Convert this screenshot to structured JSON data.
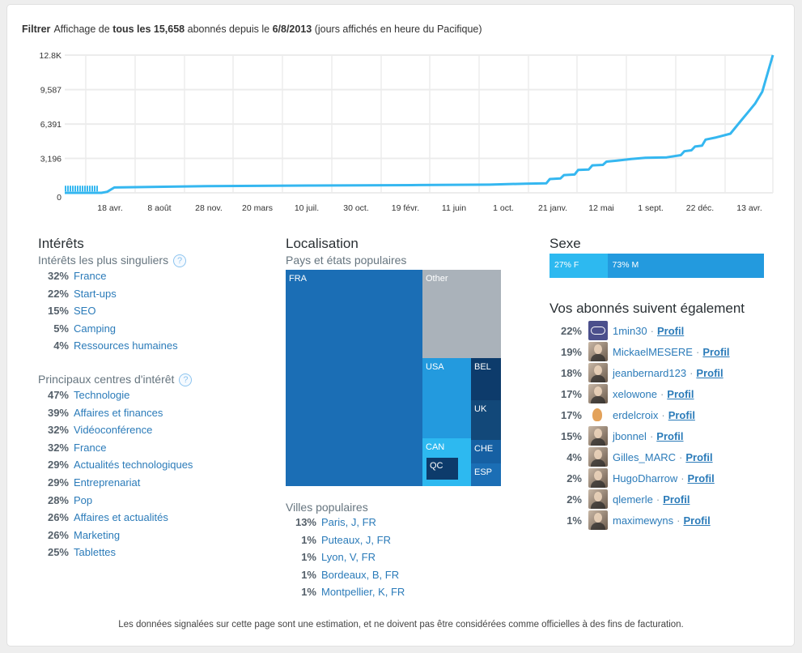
{
  "header": {
    "filter_label": "Filtrer",
    "text_parts": [
      "Affichage de ",
      "tous les 15,658",
      " abonnés depuis le ",
      "6/8/2013",
      " (jours affichés en heure du Pacifique)"
    ]
  },
  "chart_data": {
    "type": "line",
    "title": "",
    "xlabel": "",
    "ylabel": "",
    "ylim": [
      0,
      12800
    ],
    "y_ticks": [
      0,
      3196,
      6391,
      9587,
      12800
    ],
    "y_tick_labels": [
      "0",
      "3,196",
      "6,391",
      "9,587",
      "12.8K"
    ],
    "x_tick_labels": [
      "18 avr.",
      "8 août",
      "28 nov.",
      "20 mars",
      "10 juil.",
      "30 oct.",
      "19 févr.",
      "11 juin",
      "1 oct.",
      "21 janv.",
      "12 mai",
      "1 sept.",
      "22 déc.",
      "13 avr."
    ],
    "grid": true,
    "line_color": "#35b7f0",
    "series": [
      {
        "name": "abonnés",
        "x": [
          0,
          0.052,
          0.06,
          0.07,
          0.2,
          0.35,
          0.5,
          0.6,
          0.65,
          0.68,
          0.685,
          0.7,
          0.705,
          0.72,
          0.725,
          0.74,
          0.745,
          0.76,
          0.765,
          0.78,
          0.8,
          0.82,
          0.85,
          0.87,
          0.875,
          0.885,
          0.89,
          0.9,
          0.905,
          0.92,
          0.94,
          0.955,
          0.965,
          0.975,
          0.985,
          1.0
        ],
        "values": [
          0,
          0,
          100,
          500,
          620,
          680,
          720,
          760,
          850,
          880,
          1280,
          1330,
          1650,
          1700,
          2120,
          2170,
          2550,
          2600,
          2900,
          3000,
          3150,
          3250,
          3300,
          3500,
          3860,
          3950,
          4300,
          4380,
          4950,
          5150,
          5500,
          6700,
          7500,
          8300,
          9400,
          12800
        ]
      }
    ],
    "dashed_start": {
      "from": 0,
      "to": 0.048,
      "value": 400
    }
  },
  "interests": {
    "title": "Intérêts",
    "unique_title": "Intérêts les plus singuliers",
    "unique": [
      {
        "pct": "32%",
        "label": "France"
      },
      {
        "pct": "22%",
        "label": "Start-ups"
      },
      {
        "pct": "15%",
        "label": "SEO"
      },
      {
        "pct": "5%",
        "label": "Camping"
      },
      {
        "pct": "4%",
        "label": "Ressources humaines"
      }
    ],
    "top_title": "Principaux centres d'intérêt",
    "top": [
      {
        "pct": "47%",
        "label": "Technologie"
      },
      {
        "pct": "39%",
        "label": "Affaires et finances"
      },
      {
        "pct": "32%",
        "label": "Vidéoconférence"
      },
      {
        "pct": "32%",
        "label": "France"
      },
      {
        "pct": "29%",
        "label": "Actualités technologiques"
      },
      {
        "pct": "29%",
        "label": "Entreprenariat"
      },
      {
        "pct": "28%",
        "label": "Pop"
      },
      {
        "pct": "26%",
        "label": "Affaires et actualités"
      },
      {
        "pct": "26%",
        "label": "Marketing"
      },
      {
        "pct": "25%",
        "label": "Tablettes"
      }
    ],
    "help_glyph": "?"
  },
  "location": {
    "title": "Localisation",
    "countries_title": "Pays et états populaires",
    "treemap": [
      {
        "label": "FRA",
        "color": "#1b6eb5"
      },
      {
        "label": "Other",
        "color": "#aab2ba"
      },
      {
        "label": "USA",
        "color": "#239ade"
      },
      {
        "label": "BEL",
        "color": "#0d3b6b"
      },
      {
        "label": "UK",
        "color": "#124879"
      },
      {
        "label": "CAN",
        "color": "#2db9f0"
      },
      {
        "label": "QC",
        "color": "#0d3b6b"
      },
      {
        "label": "CHE",
        "color": "#1660a3"
      },
      {
        "label": "ESP",
        "color": "#1b6eb5"
      }
    ],
    "cities_title": "Villes populaires",
    "cities": [
      {
        "pct": "13%",
        "label": "Paris, J, FR"
      },
      {
        "pct": "1%",
        "label": "Puteaux, J, FR"
      },
      {
        "pct": "1%",
        "label": "Lyon, V, FR"
      },
      {
        "pct": "1%",
        "label": "Bordeaux, B, FR"
      },
      {
        "pct": "1%",
        "label": "Montpellier, K, FR"
      }
    ]
  },
  "gender": {
    "title": "Sexe",
    "female": {
      "label": "27% F",
      "fraction": 0.27,
      "color": "#2db9f0"
    },
    "male": {
      "label": "73% M",
      "fraction": 0.73,
      "color": "#239ade"
    }
  },
  "follows": {
    "title": "Vos abonnés suivent également",
    "profile_label": "Profil",
    "separator": "·",
    "items": [
      {
        "pct": "22%",
        "name": "1min30",
        "avatar": "logo-1min30"
      },
      {
        "pct": "19%",
        "name": "MickaelMESERE",
        "avatar": "photo"
      },
      {
        "pct": "18%",
        "name": "jeanbernard123",
        "avatar": "photo"
      },
      {
        "pct": "17%",
        "name": "xelowone",
        "avatar": "photo"
      },
      {
        "pct": "17%",
        "name": "erdelcroix",
        "avatar": "cartoon"
      },
      {
        "pct": "15%",
        "name": "jbonnel",
        "avatar": "photo"
      },
      {
        "pct": "4%",
        "name": "Gilles_MARC",
        "avatar": "photo"
      },
      {
        "pct": "2%",
        "name": "HugoDharrow",
        "avatar": "photo"
      },
      {
        "pct": "2%",
        "name": "qlemerle",
        "avatar": "photo"
      },
      {
        "pct": "1%",
        "name": "maximewyns",
        "avatar": "photo"
      }
    ]
  },
  "footer": {
    "disclaimer": "Les données signalées sur cette page sont une estimation, et ne doivent pas être considérées comme officielles à des fins de facturation."
  }
}
